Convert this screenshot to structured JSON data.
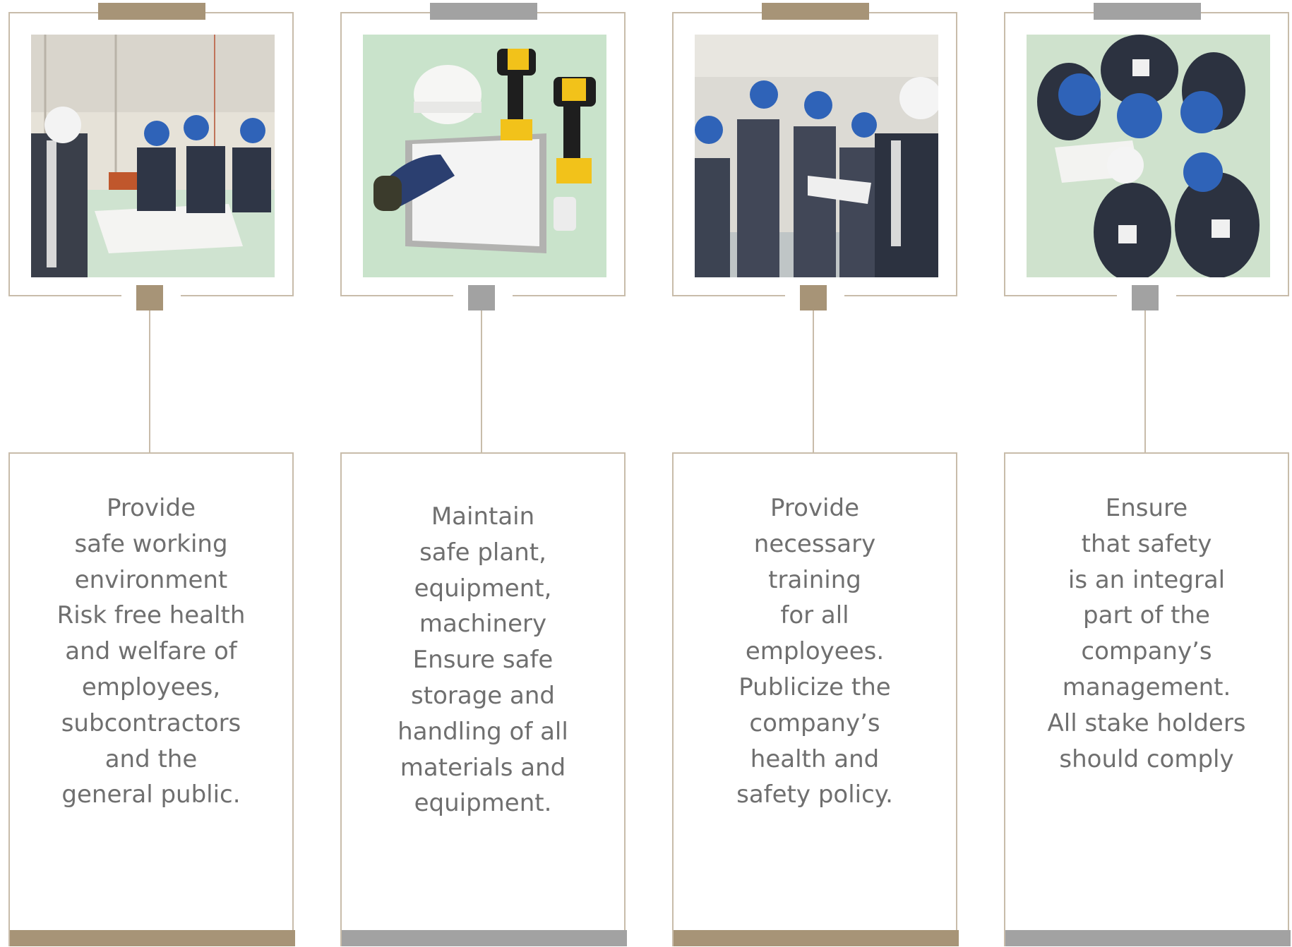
{
  "colors": {
    "tan": "#a79477",
    "gray": "#a2a2a2",
    "frame_border": "#c8bcaa",
    "text": "#6f6f6f"
  },
  "columns": [
    {
      "accent": "tan",
      "photo_icon": "team-reviewing-plans-photo",
      "text": "Provide\nsafe working\nenvironment\nRisk free health\nand welfare of\nemployees,\nsubcontractors\nand the\ngeneral public."
    },
    {
      "accent": "gray",
      "photo_icon": "safety-equipment-photo",
      "text": "Maintain\nsafe plant,\nequipment,\nmachinery\nEnsure safe\nstorage and\nhandling of all\nmaterials and\nequipment."
    },
    {
      "accent": "tan",
      "photo_icon": "training-session-photo",
      "text": "Provide\nnecessary\ntraining\nfor all\nemployees.\nPublicize the\ncompany’s\nhealth and\nsafety policy."
    },
    {
      "accent": "gray",
      "photo_icon": "overhead-team-huddle-photo",
      "text": "Ensure\nthat safety\nis an integral\npart of the\ncompany’s\nmanagement.\nAll stake holders\nshould comply"
    }
  ]
}
